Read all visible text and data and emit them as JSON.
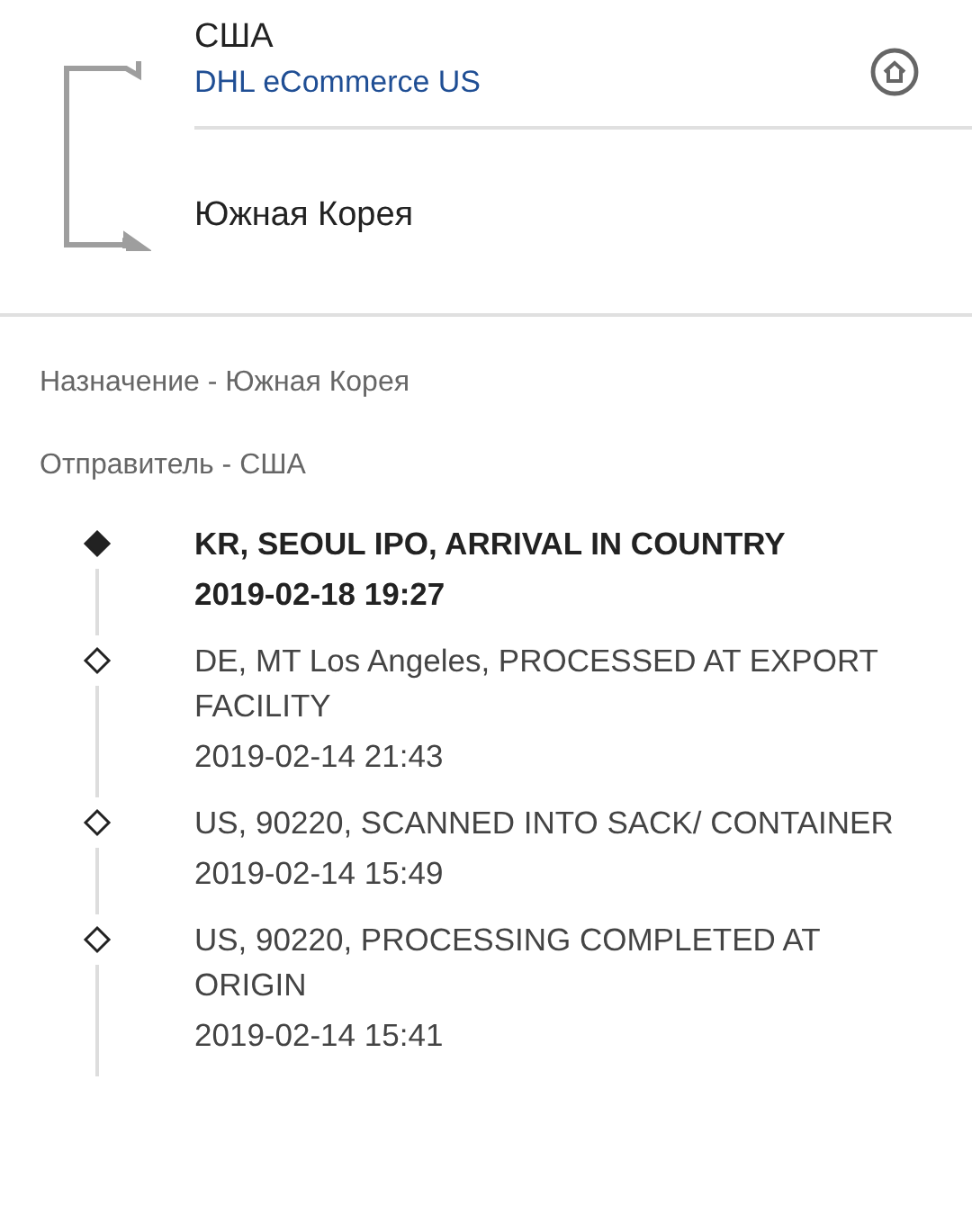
{
  "route": {
    "origin": "США",
    "carrier": "DHL eCommerce US",
    "destination": "Южная Корея"
  },
  "destination_label": "Назначение - Южная Корея",
  "sender_label": "Отправитель - США",
  "events": [
    {
      "description": "KR, SEOUL IPO, ARRIVAL IN COUNTRY",
      "time": "2019-02-18 19:27",
      "latest": true
    },
    {
      "description": "DE, MT Los Angeles, PROCESSED AT EXPORT FACILITY",
      "time": "2019-02-14 21:43",
      "latest": false
    },
    {
      "description": "US, 90220, SCANNED INTO SACK/ CONTAINER",
      "time": "2019-02-14 15:49",
      "latest": false
    },
    {
      "description": "US, 90220, PROCESSING COMPLETED AT ORIGIN",
      "time": "2019-02-14 15:41",
      "latest": false
    }
  ]
}
